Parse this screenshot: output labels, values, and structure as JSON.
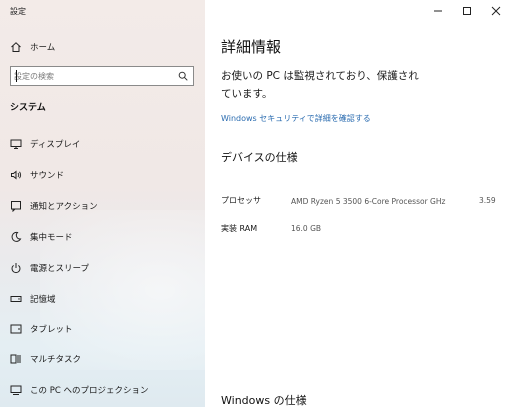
{
  "window": {
    "title": "設定"
  },
  "sidebar": {
    "home_label": "ホーム",
    "search_placeholder": "設定の検索",
    "section_title": "システム",
    "items": [
      {
        "label": "ディスプレイ",
        "icon": "monitor-icon"
      },
      {
        "label": "サウンド",
        "icon": "speaker-icon"
      },
      {
        "label": "通知とアクション",
        "icon": "notification-icon"
      },
      {
        "label": "集中モード",
        "icon": "moon-icon"
      },
      {
        "label": "電源とスリープ",
        "icon": "power-icon"
      },
      {
        "label": "記憶域",
        "icon": "storage-icon"
      },
      {
        "label": "タブレット",
        "icon": "tablet-icon"
      },
      {
        "label": "マルチタスク",
        "icon": "multitask-icon"
      },
      {
        "label": "この PC へのプロジェクション",
        "icon": "projection-icon"
      }
    ]
  },
  "main": {
    "title": "詳細情報",
    "status_line1": "お使いの PC は監視されており、保護され",
    "status_line2": "ています。",
    "security_link": "Windows セキュリティで詳細を確認する",
    "device_spec_heading": "デバイスの仕様",
    "specs": [
      {
        "label": "プロセッサ",
        "value": "AMD Ryzen 5 3500 6-Core Processor GHz",
        "extra": "3.59"
      },
      {
        "label": "実装 RAM",
        "value": "16.0 GB",
        "extra": ""
      }
    ],
    "windows_spec_heading": "Windows の仕様"
  },
  "colors": {
    "link": "#2b6cb0",
    "sidebar_bg": "#f0e8e6",
    "main_bg": "#ffffff"
  }
}
